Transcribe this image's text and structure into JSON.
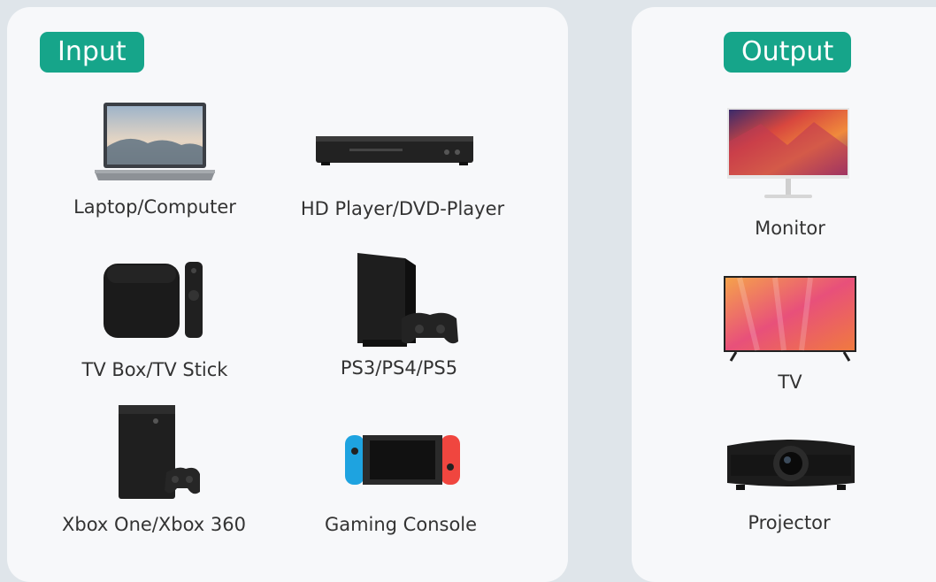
{
  "input": {
    "title": "Input",
    "devices": [
      {
        "label": "Laptop/Computer",
        "icon": "laptop-icon"
      },
      {
        "label": "HD Player/DVD-Player",
        "icon": "dvd-player-icon"
      },
      {
        "label": "TV Box/TV Stick",
        "icon": "tv-box-icon"
      },
      {
        "label": "PS3/PS4/PS5",
        "icon": "playstation-icon"
      },
      {
        "label": "Xbox One/Xbox 360",
        "icon": "xbox-icon"
      },
      {
        "label": "Gaming Console",
        "icon": "switch-console-icon"
      }
    ]
  },
  "output": {
    "title": "Output",
    "devices": [
      {
        "label": "Monitor",
        "icon": "monitor-icon"
      },
      {
        "label": "TV",
        "icon": "tv-icon"
      },
      {
        "label": "Projector",
        "icon": "projector-icon"
      }
    ]
  },
  "colors": {
    "accent": "#16a58a",
    "panel": "#f7f8fa",
    "background": "#dfe5ea"
  }
}
